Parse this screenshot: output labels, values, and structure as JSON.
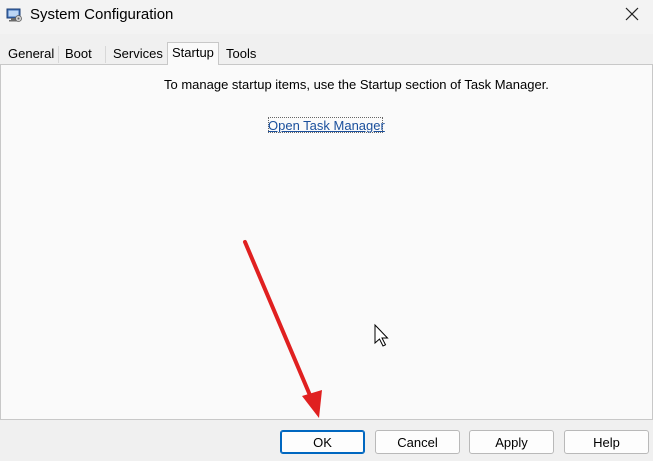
{
  "window": {
    "title": "System Configuration",
    "icon": "system-config-icon",
    "close_icon": "close-icon"
  },
  "tabs": [
    {
      "label": "General"
    },
    {
      "label": "Boot"
    },
    {
      "label": "Services"
    },
    {
      "label": "Startup",
      "active": true
    },
    {
      "label": "Tools"
    }
  ],
  "startup": {
    "message": "To manage startup items, use the Startup section of Task Manager.",
    "link": "Open Task Manager"
  },
  "buttons": {
    "ok": "OK",
    "cancel": "Cancel",
    "apply": "Apply",
    "help": "Help"
  },
  "colors": {
    "link": "#1a4f9c",
    "default_button_border": "#0067c0",
    "annotation_arrow": "#e02020"
  }
}
